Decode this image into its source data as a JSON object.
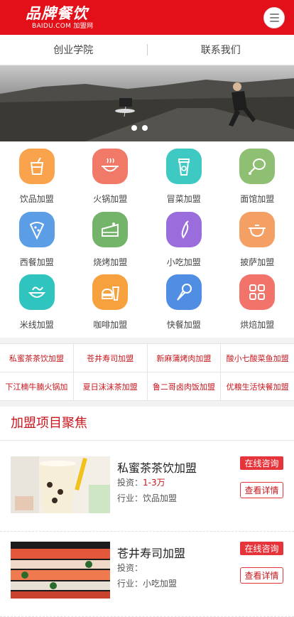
{
  "header": {
    "logo_main": "品牌餐饮",
    "logo_sub": "BAIDU.COM 加盟网",
    "menu_icon": "menu-icon"
  },
  "subnav": {
    "items": [
      "创业学院",
      "联系我们"
    ]
  },
  "banner": {
    "slide_count": 2
  },
  "categories": [
    {
      "label": "饮品加盟",
      "icon": "drink-cup-icon",
      "color": "#f9a34d"
    },
    {
      "label": "火锅加盟",
      "icon": "hotpot-icon",
      "color": "#f17967"
    },
    {
      "label": "冒菜加盟",
      "icon": "coffee-cup-icon",
      "color": "#3ec9c3"
    },
    {
      "label": "面馆加盟",
      "icon": "chicken-leg-icon",
      "color": "#8fbf72"
    },
    {
      "label": "西餐加盟",
      "icon": "pizza-icon",
      "color": "#5b9ee6"
    },
    {
      "label": "烧烤加盟",
      "icon": "cake-icon",
      "color": "#74b46a"
    },
    {
      "label": "小吃加盟",
      "icon": "chili-icon",
      "color": "#9a6cdc"
    },
    {
      "label": "披萨加盟",
      "icon": "pan-icon",
      "color": "#f4a064"
    },
    {
      "label": "米线加盟",
      "icon": "noodle-bowl-icon",
      "color": "#2fc4bd"
    },
    {
      "label": "咖啡加盟",
      "icon": "burger-drink-icon",
      "color": "#f6a13d"
    },
    {
      "label": "快餐加盟",
      "icon": "ice-cream-icon",
      "color": "#4f8ee3"
    },
    {
      "label": "烘焙加盟",
      "icon": "grid-squares-icon",
      "color": "#f1736a"
    }
  ],
  "tags": [
    [
      "私蜜茶茶饮加盟",
      "苍井寿司加盟",
      "新麻蒲烤肉加盟",
      "酸小七酸菜鱼加盟"
    ],
    [
      "下江楠牛腩火锅加",
      "夏日沫沫茶加盟",
      "鲁二哥卤肉饭加盟",
      "优粮生活快餐加盟"
    ]
  ],
  "featured": {
    "title": "加盟项目聚焦",
    "items": [
      {
        "name": "私蜜茶茶饮加盟",
        "invest_label": "投资：",
        "invest_value": "1-3万",
        "industry_label": "行业：",
        "industry_value": "饮品加盟",
        "consult": "在线咨询",
        "detail": "查看详情"
      },
      {
        "name": "苍井寿司加盟",
        "invest_label": "投资：",
        "invest_value": "",
        "industry_label": "行业：",
        "industry_value": "小吃加盟",
        "consult": "在线咨询",
        "detail": "查看详情"
      }
    ]
  }
}
